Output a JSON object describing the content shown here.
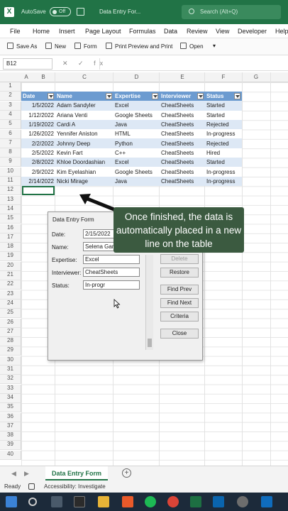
{
  "titlebar": {
    "app_icon": "X",
    "autosave_label": "AutoSave",
    "autosave_state": "Off",
    "doc_title": "Data Entry For...",
    "search_placeholder": "Search (Alt+Q)"
  },
  "menu": [
    "File",
    "Home",
    "Insert",
    "Page Layout",
    "Formulas",
    "Data",
    "Review",
    "View",
    "Developer",
    "Help"
  ],
  "toolbar": {
    "save_as": "Save As",
    "new": "New",
    "form": "Form",
    "print_preview": "Print Preview and Print",
    "open": "Open",
    "more": "▾"
  },
  "formula_bar": {
    "name_box": "B12",
    "fx_symbols": "✕ ✓ fx"
  },
  "columns": [
    "A",
    "B",
    "C",
    "D",
    "E",
    "F",
    "G"
  ],
  "row_numbers": [
    "1",
    "2",
    "3",
    "4",
    "5",
    "6",
    "7",
    "8",
    "9",
    "10",
    "11",
    "12",
    "13",
    "14",
    "15",
    "16",
    "17",
    "18",
    "19",
    "20",
    "21",
    "22",
    "23",
    "24",
    "25",
    "26",
    "27",
    "28",
    "29",
    "30",
    "31",
    "32",
    "33",
    "34",
    "35",
    "36",
    "37",
    "38",
    "39",
    "40"
  ],
  "table": {
    "headers": [
      "Date",
      "Name",
      "Expertise",
      "Interviewer",
      "Status"
    ],
    "rows": [
      [
        "1/5/2022",
        "Adam Sandyler",
        "Excel",
        "CheatSheets",
        "Started"
      ],
      [
        "1/12/2022",
        "Ariana Venti",
        "Google Sheets",
        "CheatSheets",
        "Started"
      ],
      [
        "1/19/2022",
        "Cardi A",
        "Java",
        "CheatSheets",
        "Rejected"
      ],
      [
        "1/26/2022",
        "Yennifer Aniston",
        "HTML",
        "CheatSheets",
        "In-progress"
      ],
      [
        "2/2/2022",
        "Johnny Deep",
        "Python",
        "CheatSheets",
        "Rejected"
      ],
      [
        "2/5/2022",
        "Kevin Fart",
        "C++",
        "CheatSheets",
        "Hired"
      ],
      [
        "2/8/2022",
        "Khloe Doordashian",
        "Excel",
        "CheatSheets",
        "Started"
      ],
      [
        "2/9/2022",
        "Kim Eyelashian",
        "Google Sheets",
        "CheatSheets",
        "In-progress"
      ],
      [
        "2/14/2022",
        "Nicki Mirage",
        "Java",
        "CheatSheets",
        "In-progress"
      ]
    ]
  },
  "data_form": {
    "title": "Data Entry Form",
    "fields": [
      {
        "label": "Date:",
        "value": "2/15/2022"
      },
      {
        "label": "Name:",
        "value": "Selena Gamez"
      },
      {
        "label": "Expertise:",
        "value": "Excel"
      },
      {
        "label": "Interviewer:",
        "value": "CheatSheets"
      },
      {
        "label": "Status:",
        "value": "In-progr"
      }
    ],
    "buttons": [
      "Delete",
      "Restore",
      "Find Prev",
      "Find Next",
      "Criteria",
      "Close"
    ]
  },
  "callout": "Once finished, the data is automatically placed in a new line on the table",
  "sheet_tabs": {
    "active": "Data Entry Form",
    "add": "+"
  },
  "status": {
    "ready": "Ready",
    "accessibility": "Accessibility: Investigate"
  },
  "colors": {
    "excel_green": "#217346",
    "table_header": "#6c9bd0",
    "band": "#dde8f5",
    "callout_bg": "#3b5a40"
  }
}
